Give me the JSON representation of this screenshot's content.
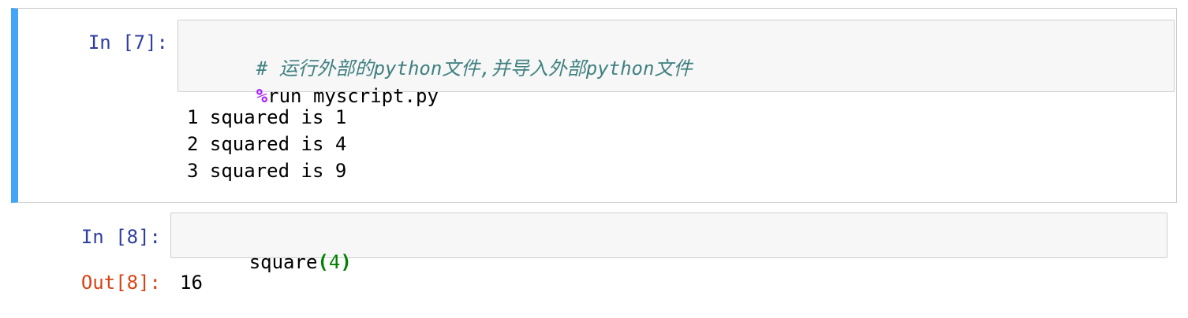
{
  "cells": [
    {
      "in_prompt": "In [7]:",
      "code_comment": "# 运行外部的python文件,并导入外部python文件",
      "code_magic_symbol": "%",
      "code_magic_rest": "run myscript.py",
      "stdout": [
        "1 squared is 1",
        "2 squared is 4",
        "3 squared is 9"
      ]
    },
    {
      "in_prompt": "In [8]:",
      "code_func": "square",
      "code_open": "(",
      "code_arg": "4",
      "code_close": ")",
      "out_prompt": "Out[8]:",
      "result": "16"
    }
  ],
  "colors": {
    "selected_bar": "#42a5f5",
    "in_prompt": "#303f9f",
    "out_prompt": "#d84315",
    "comment": "#408080",
    "magic": "#aa22ff",
    "number": "#008000",
    "input_bg": "#f7f7f7"
  }
}
